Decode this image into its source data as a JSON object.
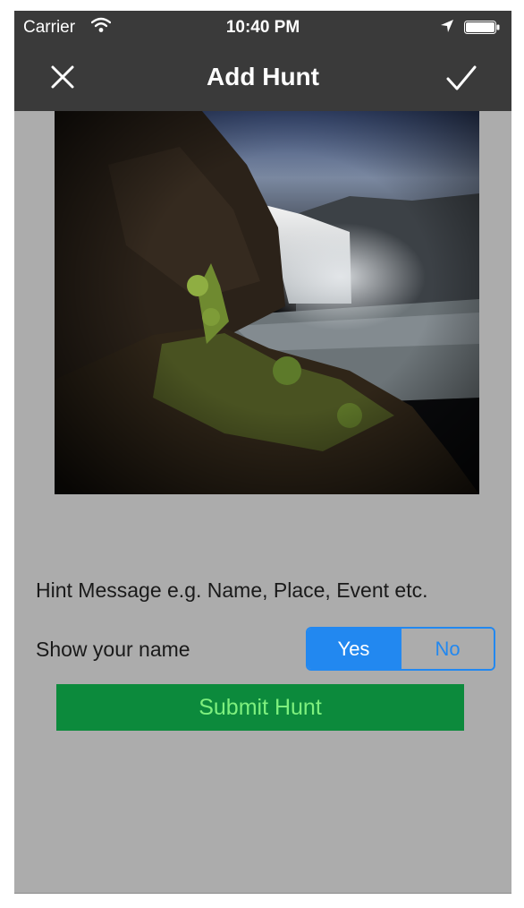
{
  "status_bar": {
    "carrier": "Carrier",
    "time": "10:40 PM",
    "icons": [
      "wifi-icon",
      "location-arrow-icon",
      "battery-icon"
    ]
  },
  "nav": {
    "title": "Add Hunt",
    "left_icon": "close-icon",
    "right_icon": "checkmark-icon"
  },
  "photo": {
    "subject": "waterfall landscape photo"
  },
  "form": {
    "hint_message": "Hint Message e.g. Name, Place, Event etc.",
    "show_name_label": "Show your name",
    "segmented_options": [
      "Yes",
      "No"
    ],
    "selected_option": "Yes",
    "submit_label": "Submit Hunt"
  },
  "colors": {
    "background": "#acacac",
    "navbar": "#3a3a3a",
    "segment_accent": "#2288f0",
    "submit_bg": "#0c8a3c",
    "submit_text": "#7ef07e"
  }
}
